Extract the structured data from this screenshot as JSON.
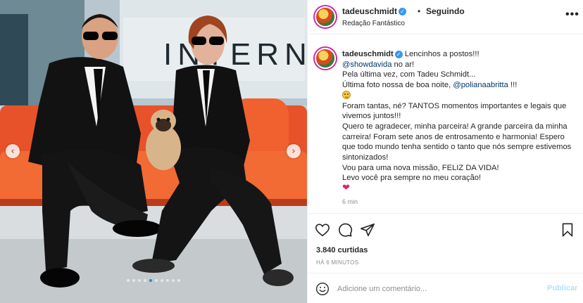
{
  "photo": {
    "background_text": "INTERN",
    "carousel": {
      "count": 10,
      "active_index": 4
    },
    "prev_icon": "chevron-left-icon",
    "next_icon": "chevron-right-icon"
  },
  "header": {
    "username": "tadeuschmidt",
    "separator": "•",
    "follow_label": "Seguindo",
    "subtitle": "Redação Fantástico",
    "more_icon": "more-horizontal-icon",
    "more_glyph": "•••"
  },
  "caption": {
    "username": "tadeuschmidt",
    "line1": " Lencinhos a postos!!!",
    "mention1": "@showdavida",
    "line2": " no ar!",
    "line3": "Pela última vez, com Tadeu Schmidt...",
    "line4": "Última foto nossa de boa noite, ",
    "mention2": "@polianaabritta",
    "line4_end": " !!!",
    "line5": "Foram tantas, né? TANTOS momentos importantes e legais que vivemos juntos!!!",
    "line6": "Quero te agradecer, minha parceira! A grande parceira da minha carreira! Foram sete anos de entrosamento e harmonia! Espero que todo mundo tenha sentido o tanto que nós sempre estivemos sintonizados!",
    "line7": "Vou para uma nova missão, FELIZ DA VIDA!",
    "line8": "Levo você pra sempre no meu coração!",
    "heart": "❤",
    "time": "6 min"
  },
  "actions": {
    "like_icon": "heart-icon",
    "comment_icon": "comment-icon",
    "share_icon": "share-icon",
    "save_icon": "bookmark-icon",
    "likes": "3.840 curtidas",
    "ago": "HÁ 6 MINUTOS"
  },
  "comment": {
    "emoji_icon": "smiley-icon",
    "placeholder": "Adicione um comentário...",
    "publish_label": "Publicar"
  },
  "colors": {
    "accent_blue": "#0095f6",
    "verified_blue": "#3897f0",
    "publish_disabled": "#b2dffc",
    "sofa_orange": "#e8522a",
    "mention_blue": "#00376b"
  }
}
